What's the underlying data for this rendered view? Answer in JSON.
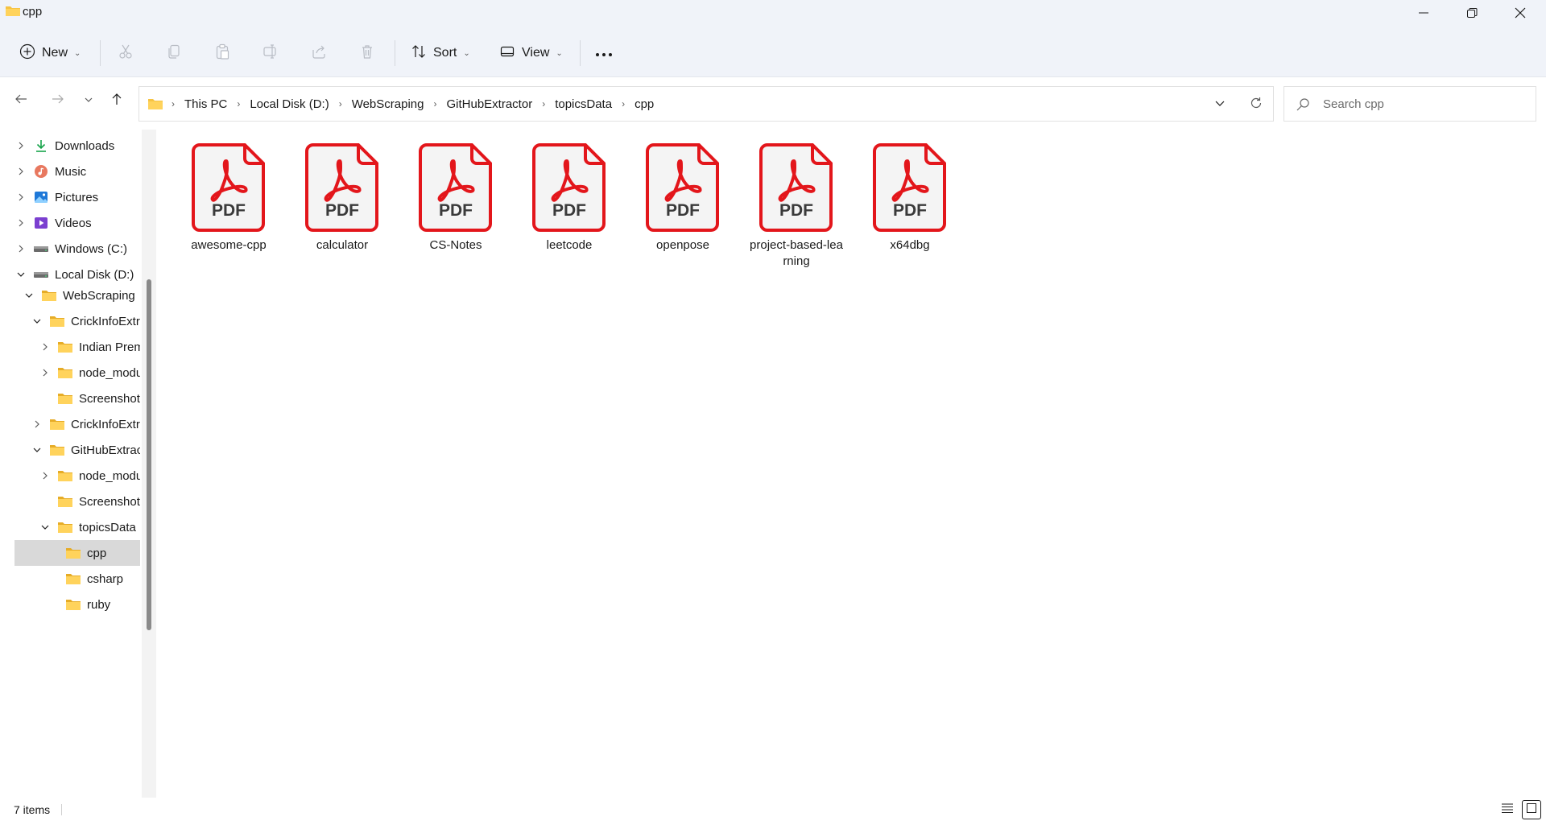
{
  "window": {
    "title": "cpp",
    "minimize_icon": "minimize-icon",
    "restore_icon": "restore-icon",
    "close_icon": "close-icon"
  },
  "toolbar": {
    "new_label": "New",
    "sort_label": "Sort",
    "view_label": "View",
    "icons": [
      "new-icon",
      "cut-icon",
      "copy-icon",
      "paste-icon",
      "rename-icon",
      "share-icon",
      "delete-icon",
      "sort-icon",
      "view-icon",
      "more-icon"
    ]
  },
  "address": {
    "breadcrumbs": [
      "This PC",
      "Local Disk (D:)",
      "WebScraping",
      "GitHubExtractor",
      "topicsData",
      "cpp"
    ]
  },
  "search": {
    "placeholder": "Search cpp",
    "value": ""
  },
  "sidebar": {
    "items": [
      {
        "label": "Downloads",
        "icon": "download-icon",
        "expander": "collapsed"
      },
      {
        "label": "Music",
        "icon": "music-icon",
        "expander": "collapsed"
      },
      {
        "label": "Pictures",
        "icon": "pictures-icon",
        "expander": "collapsed"
      },
      {
        "label": "Videos",
        "icon": "videos-icon",
        "expander": "collapsed"
      },
      {
        "label": "Windows (C:)",
        "icon": "drive-icon",
        "expander": "collapsed"
      },
      {
        "label": "Local Disk (D:)",
        "icon": "drive-icon",
        "expander": "expanded"
      },
      {
        "label": "WebScraping",
        "icon": "folder-icon",
        "expander": "expanded"
      },
      {
        "label": "CrickInfoExtra",
        "icon": "folder-icon",
        "expander": "expanded"
      },
      {
        "label": "Indian Prem",
        "icon": "folder-icon",
        "expander": "collapsed"
      },
      {
        "label": "node_modu",
        "icon": "folder-icon",
        "expander": "collapsed"
      },
      {
        "label": "Screenshots",
        "icon": "folder-icon",
        "expander": "none"
      },
      {
        "label": "CrickInfoExtra",
        "icon": "folder-icon",
        "expander": "collapsed"
      },
      {
        "label": "GitHubExtrac",
        "icon": "folder-icon",
        "expander": "expanded"
      },
      {
        "label": "node_modu",
        "icon": "folder-icon",
        "expander": "collapsed"
      },
      {
        "label": "Screenshots",
        "icon": "folder-icon",
        "expander": "none"
      },
      {
        "label": "topicsData",
        "icon": "folder-icon",
        "expander": "expanded"
      },
      {
        "label": "cpp",
        "icon": "folder-icon",
        "expander": "none",
        "selected": true
      },
      {
        "label": "csharp",
        "icon": "folder-icon",
        "expander": "none"
      },
      {
        "label": "ruby",
        "icon": "folder-icon",
        "expander": "none"
      }
    ]
  },
  "files": [
    {
      "name": "awesome-cpp",
      "type": "PDF"
    },
    {
      "name": "calculator",
      "type": "PDF"
    },
    {
      "name": "CS-Notes",
      "type": "PDF"
    },
    {
      "name": "leetcode",
      "type": "PDF"
    },
    {
      "name": "openpose",
      "type": "PDF"
    },
    {
      "name": "project-based-learning",
      "type": "PDF"
    },
    {
      "name": "x64dbg",
      "type": "PDF"
    }
  ],
  "status": {
    "item_count": "7 items"
  },
  "colors": {
    "pdf_red": "#e3161b",
    "folder_yellow": "#f6c342",
    "selected_bg": "#d9d9d9"
  }
}
